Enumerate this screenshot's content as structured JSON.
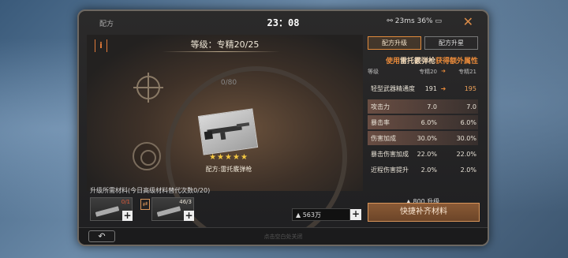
{
  "status": {
    "title": "配方",
    "time": "23：08",
    "network": "23ms",
    "battery": "36%"
  },
  "info_label": "i",
  "level_title": "等级：专精20/25",
  "progress": "0/80",
  "item_name": "配方:雷托霰弹枪",
  "stars": "★★★★★",
  "tabs": [
    "配方升级",
    "配方升星"
  ],
  "bonus": {
    "prefix": "使用",
    "weapon": "雷托霰弹枪",
    "suffix": "获得额外属性"
  },
  "stats_header": {
    "label": "等级",
    "current": "专精20",
    "next": "专精21"
  },
  "stats": [
    {
      "label": "轻型武器精通度",
      "v1": "191",
      "v2": "195"
    },
    {
      "label": "攻击力",
      "v1": "7.0",
      "v2": "7.0"
    },
    {
      "label": "暴击率",
      "v1": "6.0%",
      "v2": "6.0%"
    },
    {
      "label": "伤害加成",
      "v1": "30.0%",
      "v2": "30.0%"
    },
    {
      "label": "暴击伤害加成",
      "v1": "22.0%",
      "v2": "22.0%"
    },
    {
      "label": "近程伤害提升",
      "v1": "2.0%",
      "v2": "2.0%"
    }
  ],
  "materials": {
    "title": "升级所需材料(今日高级材料替代次数0/20)",
    "item1_count": "0/1",
    "item2_count": "46/3",
    "currency": "563万"
  },
  "upgrade_cost": "800 升级",
  "fill_button": "快捷补齐材料",
  "footer_hint": "点击空白处关闭",
  "colors": {
    "accent": "#e88a3a",
    "panel": "#232323"
  }
}
